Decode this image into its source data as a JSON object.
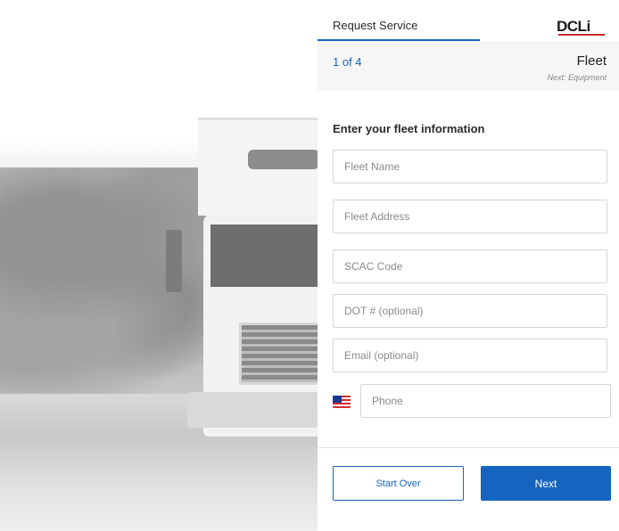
{
  "header": {
    "title": "Request Service",
    "logo_text": "DCLi"
  },
  "progress": {
    "step_count": "1 of 4",
    "step_name": "Fleet",
    "next_step": "Next: Equipment"
  },
  "form": {
    "heading": "Enter your fleet information",
    "fleet_name_placeholder": "Fleet Name",
    "fleet_address_placeholder": "Fleet Address",
    "scac_placeholder": "SCAC Code",
    "dot_placeholder": "DOT # (optional)",
    "email_placeholder": "Email (optional)",
    "phone_placeholder": "Phone",
    "phone_country_icon": "us-flag-icon"
  },
  "actions": {
    "start_over_label": "Start Over",
    "next_label": "Next"
  },
  "colors": {
    "accent": "#1565c0",
    "band_bg": "#f6f6f6",
    "border": "#d6d6d6"
  }
}
